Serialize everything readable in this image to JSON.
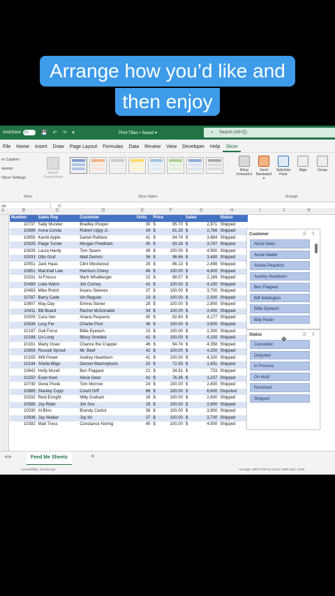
{
  "overlay": {
    "line1": "Arrange how you’d like and",
    "line2": "then enjoy"
  },
  "titlebar": {
    "autosave_label": "AutoSave",
    "autosave_state": "On",
    "quick_access": "💾 ↶ ↷ ▾",
    "doc_title": "Print Titles • Saved ▾",
    "search_placeholder": "Search (Alt+Q)"
  },
  "menu": [
    "File",
    "Home",
    "Insert",
    "Draw",
    "Page Layout",
    "Formulas",
    "Data",
    "Review",
    "View",
    "Developer",
    "Help",
    "Slicer"
  ],
  "ribbon": {
    "left_items": [
      "er Caption:",
      "stomer",
      "Slicer Settings"
    ],
    "report_connections": "Report Connections",
    "group_slicer": "Slicer",
    "group_styles": "Slicer Styles",
    "group_arrange": "Arrange",
    "buttons": [
      "Bring Forward ▾",
      "Send Backward ▾",
      "Selection Pane",
      "Align",
      "Group"
    ]
  },
  "formula": {
    "namebox": "on",
    "fx": "fx"
  },
  "columns": [
    "A",
    "B",
    "C",
    "D",
    "E",
    "F",
    "G",
    "H",
    "I",
    "J",
    "K"
  ],
  "table": {
    "headers": [
      "Number",
      "Sales Rep",
      "Customer",
      "Units",
      "Price",
      "",
      "Sales",
      "",
      "Status"
    ],
    "rows": [
      [
        "10737",
        "Sally Munder",
        "Bradley Pooper",
        "30",
        "$",
        "95.70",
        "$",
        "2,871",
        "Shipped"
      ],
      [
        "10696",
        "Anna Conda",
        "Robert Uppy Jr.",
        "34",
        "$",
        "81.35",
        "$",
        "2,766",
        "Shipped"
      ],
      [
        "10656",
        "Kandi Apple",
        "Daniel Ratface",
        "41",
        "$",
        "94.74",
        "$",
        "3,884",
        "Shipped"
      ],
      [
        "10925",
        "Paige Turner",
        "Morgan Friedham",
        "45",
        "$",
        "83.26",
        "$",
        "3,747",
        "Shipped"
      ],
      [
        "10639",
        "Laura Hardy",
        "Tom Spanx",
        "49",
        "$",
        "100.00",
        "$",
        "4,900",
        "Shipped"
      ],
      [
        "10033",
        "Otto Graf",
        "Matt Demon",
        "36",
        "$",
        "96.66",
        "$",
        "3,480",
        "Shipped"
      ],
      [
        "10551",
        "Jack Haas",
        "Clint Westwood",
        "29",
        "$",
        "86.13",
        "$",
        "2,498",
        "Shipped"
      ],
      [
        "10651",
        "Marshall Law",
        "Harrison Chevy",
        "48",
        "$",
        "100.00",
        "$",
        "4,800",
        "Shipped"
      ],
      [
        "10331",
        "Al Fresco",
        "Mark Whalberger",
        "22",
        "$",
        "98.57",
        "$",
        "2,169",
        "Shipped"
      ],
      [
        "10489",
        "Luke Warm",
        "Jim Corney",
        "41",
        "$",
        "100.00",
        "$",
        "4,100",
        "Shipped"
      ],
      [
        "10483",
        "Mike Rotch",
        "Keanu Sleeves",
        "37",
        "$",
        "100.00",
        "$",
        "3,700",
        "Shipped"
      ],
      [
        "10787",
        "Barry Cade",
        "Vin Regular",
        "23",
        "$",
        "100.00",
        "$",
        "2,300",
        "Shipped"
      ],
      [
        "10807",
        "May Day",
        "Emma Stoner",
        "28",
        "$",
        "100.00",
        "$",
        "2,800",
        "Shipped"
      ],
      [
        "10411",
        "Bill Board",
        "Rachel McDonalds",
        "34",
        "$",
        "100.00",
        "$",
        "3,400",
        "Shipped"
      ],
      [
        "10005",
        "Cara Van",
        "Ariana Pequeno",
        "45",
        "$",
        "92.83",
        "$",
        "4,177",
        "Shipped"
      ],
      [
        "10536",
        "Lucy Fer",
        "Charlie Poot",
        "36",
        "$",
        "100.00",
        "$",
        "3,600",
        "Shipped"
      ],
      [
        "10197",
        "Gail Force",
        "Billie Eyelash",
        "23",
        "$",
        "100.00",
        "$",
        "2,300",
        "Shipped"
      ],
      [
        "10188",
        "Liv Long",
        "Missy Smelliot",
        "41",
        "$",
        "100.00",
        "$",
        "4,100",
        "Shipped"
      ],
      [
        "10161",
        "Marty Graw",
        "Chance the Crapper",
        "46",
        "$",
        "94.74",
        "$",
        "4,358",
        "Shipped"
      ],
      [
        "10659",
        "Russell Sprout",
        "Mr. Beef",
        "42",
        "$",
        "100.00",
        "$",
        "4,200",
        "Shipped"
      ],
      [
        "10155",
        "Will Power",
        "Audrey Heartburn",
        "41",
        "$",
        "100.00",
        "$",
        "4,100",
        "Shipped"
      ],
      [
        "10144",
        "Sheila Blige",
        "Denzel Washnybuns",
        "20",
        "$",
        "72.55",
        "$",
        "1,451",
        "Shipped"
      ],
      [
        "10642",
        "Holly Mcrell",
        "Ben Flapjack",
        "21",
        "$",
        "34.91",
        "$",
        "733",
        "Shipped"
      ],
      [
        "10250",
        "Evan Keel",
        "Alicia Geez",
        "42",
        "$",
        "76.36",
        "$",
        "3,207",
        "Shipped"
      ],
      [
        "10740",
        "Gene Poole",
        "Tom Morrow",
        "24",
        "$",
        "100.00",
        "$",
        "2,400",
        "Shipped"
      ],
      [
        "10885",
        "Stanley Cupp",
        "Count Orff",
        "66",
        "$",
        "100.00",
        "$",
        "6,600",
        "Disputed"
      ],
      [
        "10332",
        "Reid Enright",
        "Milly Graham",
        "26",
        "$",
        "100.00",
        "$",
        "2,600",
        "Shipped"
      ],
      [
        "10588",
        "Joy Rider",
        "Jim Sox",
        "29",
        "$",
        "100.00",
        "$",
        "2,900",
        "Shipped"
      ],
      [
        "10030",
        "Al Bino",
        "Brandy Cantor",
        "38",
        "$",
        "100.00",
        "$",
        "3,800",
        "Shipped"
      ],
      [
        "10936",
        "Jay Walker",
        "Joy Kil",
        "37",
        "$",
        "100.00",
        "$",
        "3,700",
        "Shipped"
      ],
      [
        "10392",
        "Matt Tress",
        "Constance Noring",
        "45",
        "$",
        "100.00",
        "$",
        "4,500",
        "Shipped"
      ]
    ]
  },
  "slicer_customer": {
    "title": "Customer",
    "items": [
      "Alicia Geez",
      "Annie Matter",
      "Ariana Pequeno",
      "Audrey Heartburn",
      "Ben Flapjack",
      "Biff Wellington",
      "Billie Eyelash",
      "Billy Rubin"
    ]
  },
  "slicer_status": {
    "title": "Status",
    "items": [
      "Cancelled",
      "Disputed",
      "In Process",
      "On Hold",
      "Resolved",
      "Shipped"
    ]
  },
  "sheet": {
    "tab": "Feed Me Sheets",
    "add": "+"
  },
  "statusbar": {
    "accessibility": "Accessibility: Good to go",
    "stats": "Average: 3807.376744     Count: 1950     Sum: 4293"
  },
  "colors": {
    "excel_green": "#217346",
    "caption_blue": "#3d9be9",
    "header_blue": "#4472c4",
    "band": "#dbe4f4",
    "slicer_item": "#b4c6e7"
  }
}
